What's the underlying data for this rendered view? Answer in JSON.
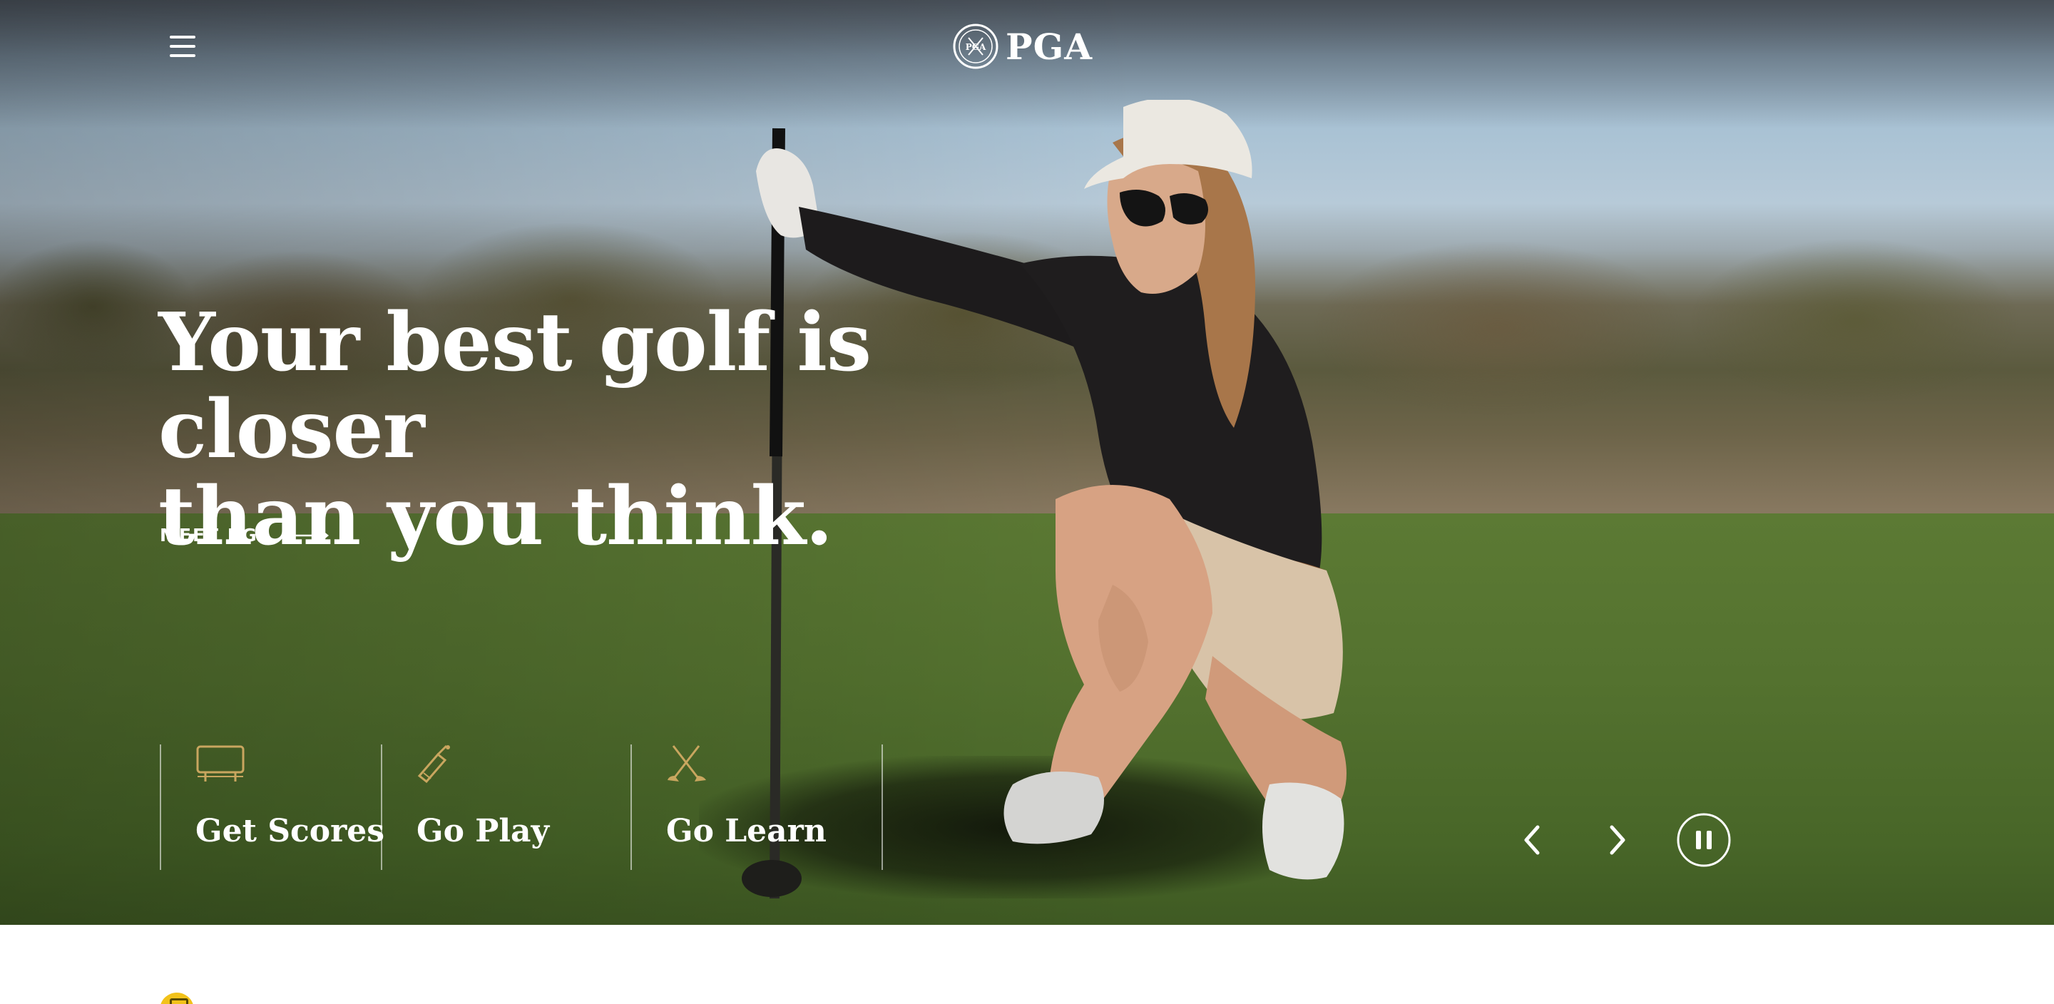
{
  "header": {
    "menu_icon": "hamburger-menu-icon",
    "logo_text": "PGA",
    "logo_seal_text": "PGA"
  },
  "hero": {
    "headline_line1": "Your best golf is closer",
    "headline_line2": "than you think.",
    "cta_label": "MEET PGA",
    "cta_icon": "arrow-right-icon"
  },
  "features": [
    {
      "label": "Get Scores",
      "icon": "scoreboard-icon"
    },
    {
      "label": "Go Play",
      "icon": "golf-bag-icon"
    },
    {
      "label": "Go Learn",
      "icon": "crossed-clubs-icon"
    }
  ],
  "carousel": {
    "prev_icon": "chevron-left-icon",
    "next_icon": "chevron-right-icon",
    "pause_icon": "pause-icon"
  },
  "colors": {
    "accent_gold": "#c9a65f",
    "text_white": "#ffffff",
    "badge_yellow": "#f2c21a"
  }
}
